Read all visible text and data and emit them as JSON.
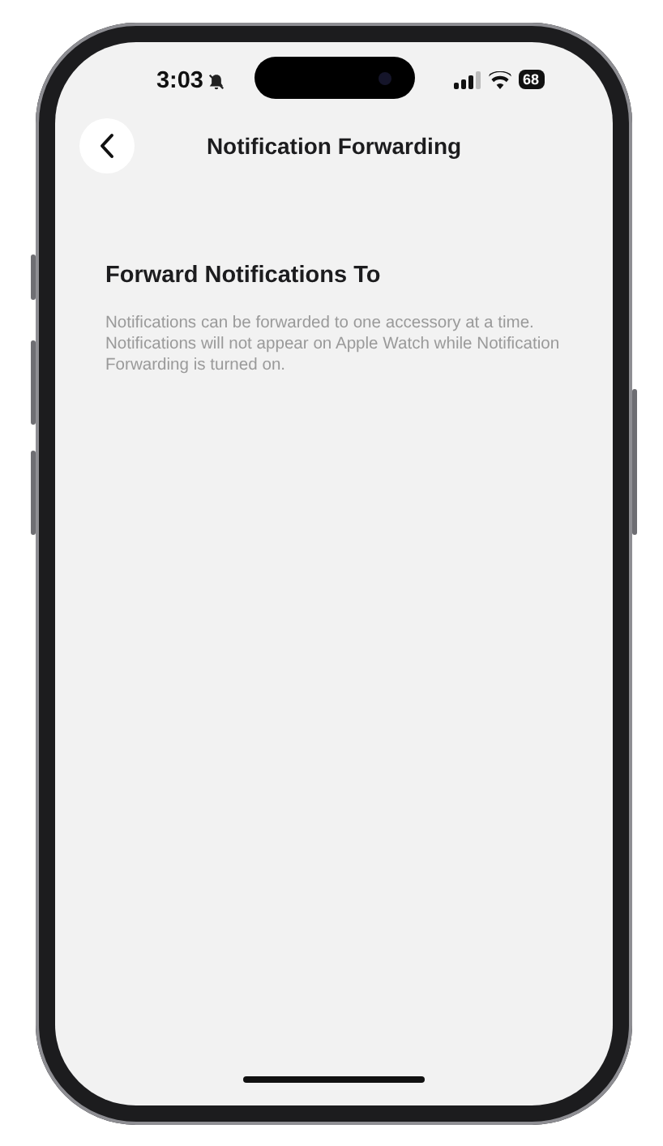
{
  "status_bar": {
    "time": "3:03",
    "battery": "68"
  },
  "nav": {
    "title": "Notification Forwarding"
  },
  "section": {
    "heading": "Forward Notifications To",
    "description": "Notifications can be forwarded to one accessory at a time. Notifications will not appear on Apple Watch while Notification Forwarding is turned on."
  }
}
